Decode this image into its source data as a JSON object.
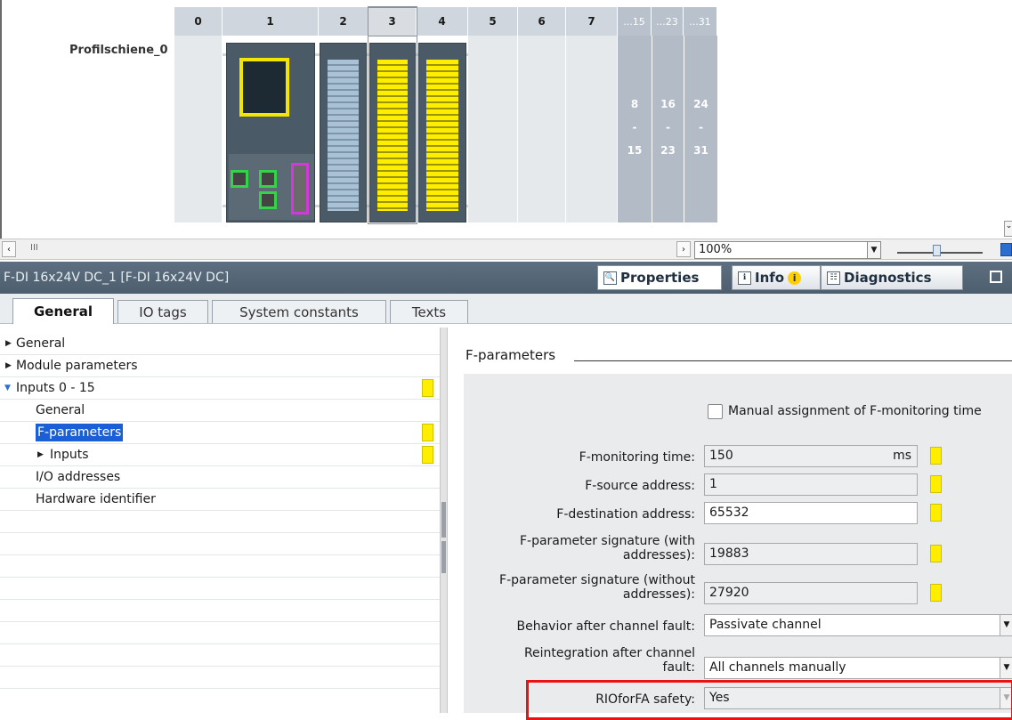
{
  "device_view": {
    "rail_name": "Profilschiene_0",
    "slots": [
      "0",
      "1",
      "2",
      "3",
      "4",
      "5",
      "6",
      "7"
    ],
    "grey_slots": [
      {
        "header": "...15",
        "top": "8",
        "dash": "-",
        "bottom": "15"
      },
      {
        "header": "...23",
        "top": "16",
        "dash": "-",
        "bottom": "23"
      },
      {
        "header": "...31",
        "top": "24",
        "dash": "-",
        "bottom": "31"
      }
    ],
    "selected_slot": "3"
  },
  "toolbar": {
    "zoom_value": "100%",
    "scroll_thumb": "III"
  },
  "inspector": {
    "title": "F-DI 16x24V DC_1 [F-DI 16x24V DC]",
    "panel_tabs": [
      "Properties",
      "Info",
      "Diagnostics"
    ],
    "sub_tabs": [
      "General",
      "IO tags",
      "System constants",
      "Texts"
    ]
  },
  "nav": {
    "items": [
      {
        "label": "General",
        "expand": "collapsed"
      },
      {
        "label": "Module parameters",
        "expand": "collapsed"
      },
      {
        "label": "Inputs 0 - 15",
        "expand": "expanded"
      },
      {
        "label": "General"
      },
      {
        "label": "F-parameters"
      },
      {
        "label": "Inputs",
        "expand": "collapsed"
      },
      {
        "label": "I/O addresses"
      },
      {
        "label": "Hardware identifier"
      }
    ]
  },
  "form": {
    "section_title": "F-parameters",
    "manual_assignment_label": "Manual assignment of F-monitoring time",
    "monitoring_time_label": "F-monitoring time:",
    "monitoring_time_value": "150",
    "monitoring_time_unit": "ms",
    "source_address_label": "F-source address:",
    "source_address_value": "1",
    "destination_address_label": "F-destination address:",
    "destination_address_value": "65532",
    "sig_with_label_1": "F-parameter signature (with",
    "sig_with_label_2": "addresses):",
    "sig_with_value": "19883",
    "sig_without_label_1": "F-parameter signature (without",
    "sig_without_label_2": "addresses):",
    "sig_without_value": "27920",
    "behavior_label": "Behavior after channel fault:",
    "behavior_value": "Passivate channel",
    "reintegration_label_1": "Reintegration after channel",
    "reintegration_label_2": "fault:",
    "reintegration_value": "All channels manually",
    "rioforfa_label": "RIOforFA safety:",
    "rioforfa_value": "Yes"
  },
  "colors": {
    "title_bar": "#4d5e6e",
    "highlight": "#e11111",
    "marker": "#ffee00",
    "selection": "#1b5fd6"
  }
}
